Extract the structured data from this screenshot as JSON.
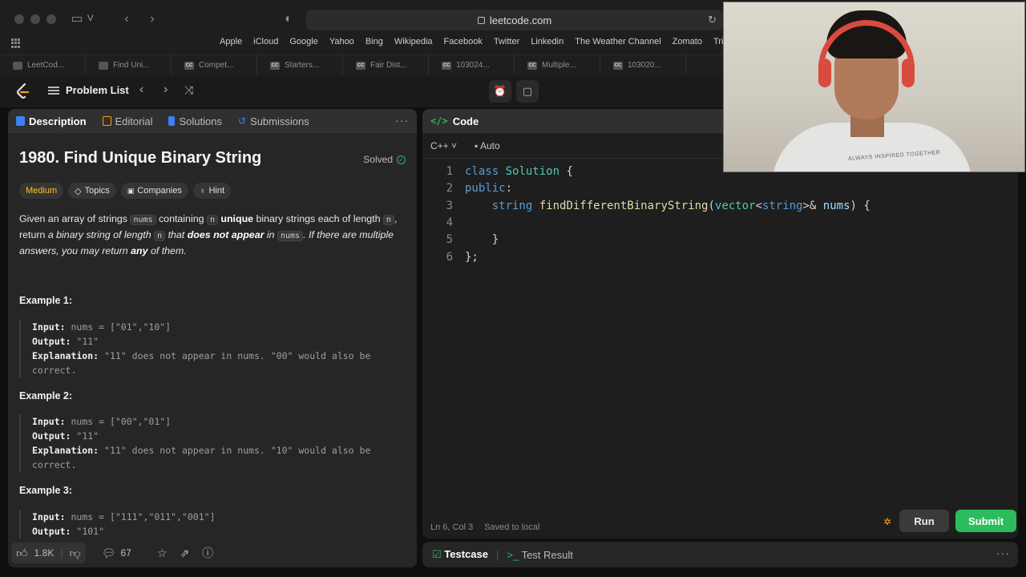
{
  "browser": {
    "url": "leetcode.com",
    "bookmarks": [
      "Apple",
      "iCloud",
      "Google",
      "Yahoo",
      "Bing",
      "Wikipedia",
      "Facebook",
      "Twitter",
      "Linkedin",
      "The Weather Channel",
      "Zomato",
      "TripAdv"
    ],
    "tabs": [
      "LeetCod...",
      "Find Uni...",
      "Compet...",
      "Starters...",
      "Fair Dist...",
      "103024...",
      "Multiple...",
      "103020..."
    ]
  },
  "topbar": {
    "problem_list": "Problem List"
  },
  "left_panel": {
    "tabs": [
      "Description",
      "Editorial",
      "Solutions",
      "Submissions"
    ],
    "title": "1980. Find Unique Binary String",
    "solved": "Solved",
    "tags": {
      "difficulty": "Medium",
      "topics": "Topics",
      "companies": "Companies",
      "hint": "Hint"
    },
    "description": {
      "p1": "Given an array of strings",
      "c1": "nums",
      "p2": "containing",
      "c2": "n",
      "b1": "unique",
      "p3": "binary strings each of length",
      "c3": "n",
      "p4": ", return",
      "i1": "a binary string of length",
      "c4": "n",
      "i2": "that",
      "b2": "does not appear",
      "i3": "in",
      "c5": "nums",
      "i4": ". If there are multiple answers, you may return",
      "b3": "any",
      "i5": "of them."
    },
    "examples": [
      {
        "heading": "Example 1:",
        "input_label": "Input:",
        "input": "nums = [\"01\",\"10\"]",
        "output_label": "Output:",
        "output": "\"11\"",
        "explanation_label": "Explanation:",
        "explanation": "\"11\" does not appear in nums. \"00\" would also be correct."
      },
      {
        "heading": "Example 2:",
        "input_label": "Input:",
        "input": "nums = [\"00\",\"01\"]",
        "output_label": "Output:",
        "output": "\"11\"",
        "explanation_label": "Explanation:",
        "explanation": "\"11\" does not appear in nums. \"10\" would also be correct."
      },
      {
        "heading": "Example 3:",
        "input_label": "Input:",
        "input": "nums = [\"111\",\"011\",\"001\"]",
        "output_label": "Output:",
        "output": "\"101\""
      }
    ],
    "footer": {
      "likes": "1.8K",
      "comments": "67"
    }
  },
  "editor": {
    "header": "Code",
    "language": "C++",
    "mode": "Auto",
    "line_numbers": [
      "1",
      "2",
      "3",
      "4",
      "5",
      "6"
    ],
    "status_position": "Ln 6, Col 3",
    "status_saved": "Saved to local",
    "run": "Run",
    "submit": "Submit"
  },
  "bottom_panel": {
    "testcase": "Testcase",
    "test_result": "Test Result"
  },
  "webcam": {
    "shirt_print": "ALWAYS INSPIRED TOGETHER"
  },
  "colors": {
    "accent_green": "#2cbb5d",
    "medium_yellow": "#ffc01e",
    "leetcode_orange": "#ffa116"
  }
}
